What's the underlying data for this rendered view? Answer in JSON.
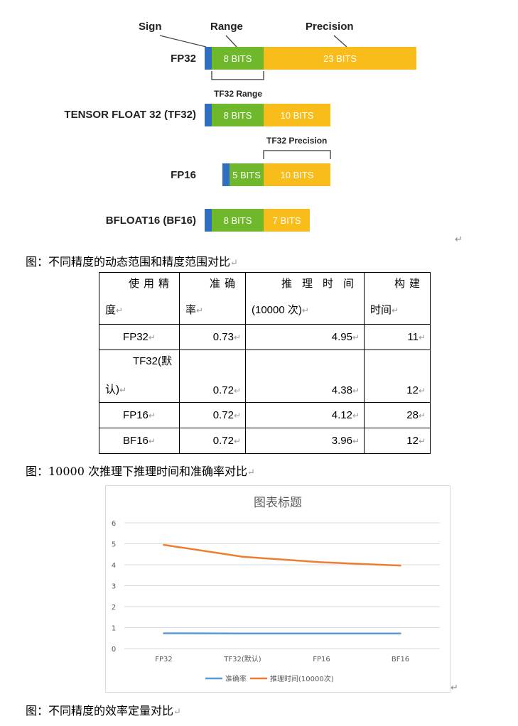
{
  "diagram": {
    "headers": {
      "sign": "Sign",
      "range": "Range",
      "precision": "Precision"
    },
    "rows": [
      {
        "label": "FP32",
        "range_bits": "8 BITS",
        "precision_bits": "23 BITS"
      },
      {
        "label": "TENSOR FLOAT 32 (TF32)",
        "range_bits": "8 BITS",
        "precision_bits": "10 BITS"
      },
      {
        "label": "FP16",
        "range_bits": "5 BITS",
        "precision_bits": "10 BITS"
      },
      {
        "label": "BFLOAT16 (BF16)",
        "range_bits": "8 BITS",
        "precision_bits": "7 BITS"
      }
    ],
    "tf32_range_label": "TF32 Range",
    "tf32_precision_label": "TF32 Precision"
  },
  "captions": {
    "fig1": "图：不同精度的动态范围和精度范围对比",
    "fig2": "图：10000 次推理下推理时间和准确率对比",
    "fig3": "图：不同精度的效率定量对比"
  },
  "table": {
    "headers": [
      {
        "line1": "使用精",
        "line2": "度"
      },
      {
        "line1": "准确",
        "line2": "率"
      },
      {
        "line1": "推理时间",
        "line2": "(10000 次)"
      },
      {
        "line1": "构建",
        "line2": "时间"
      }
    ],
    "rows": [
      {
        "precision": "FP32",
        "accuracy": "0.73",
        "infer_time": "4.95",
        "build_time": "11"
      },
      {
        "precision_line1": "TF32(默",
        "precision_line2": "认)",
        "accuracy": "0.72",
        "infer_time": "4.38",
        "build_time": "12"
      },
      {
        "precision": "FP16",
        "accuracy": "0.72",
        "infer_time": "4.12",
        "build_time": "28"
      },
      {
        "precision": "BF16",
        "accuracy": "0.72",
        "infer_time": "3.96",
        "build_time": "12"
      }
    ]
  },
  "chart_data": {
    "type": "line",
    "title": "图表标题",
    "categories": [
      "FP32",
      "TF32(默认)",
      "FP16",
      "BF16"
    ],
    "series": [
      {
        "name": "准确率",
        "values": [
          0.73,
          0.72,
          0.72,
          0.72
        ],
        "color": "#5b9bd5"
      },
      {
        "name": "推理时间(10000次)",
        "values": [
          4.95,
          4.38,
          4.12,
          3.96
        ],
        "color": "#ed7d31"
      }
    ],
    "ylim": [
      0,
      6
    ],
    "yticks": [
      0,
      1,
      2,
      3,
      4,
      5,
      6
    ],
    "grid": true,
    "legend": "bottom"
  },
  "colors": {
    "sign": "#2e6fc4",
    "range": "#6fb82c",
    "precision": "#f8bd1a"
  }
}
